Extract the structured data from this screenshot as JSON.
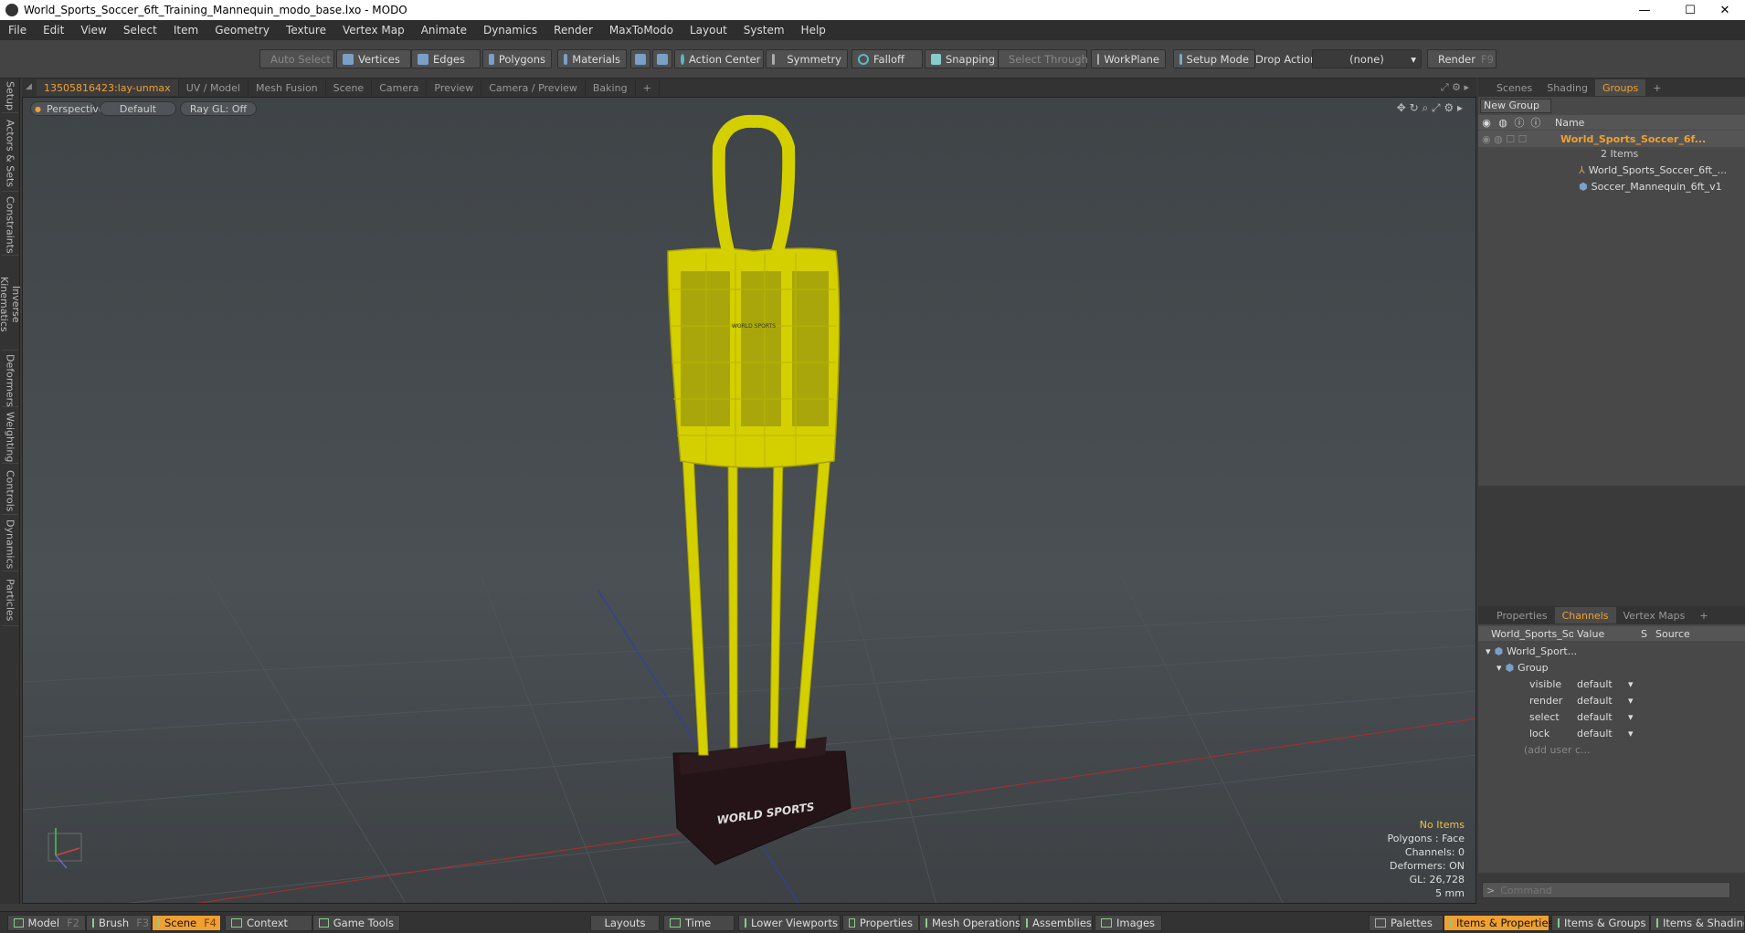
{
  "window": {
    "title": "World_Sports_Soccer_6ft_Training_Mannequin_modo_base.lxo - MODO",
    "minimize": "—",
    "maximize": "☐",
    "close": "✕"
  },
  "menu": [
    "File",
    "Edit",
    "View",
    "Select",
    "Item",
    "Geometry",
    "Texture",
    "Vertex Map",
    "Animate",
    "Dynamics",
    "Render",
    "MaxToModo",
    "Layout",
    "System",
    "Help"
  ],
  "toolbar": {
    "auto_select": "Auto Select",
    "vertices": "Vertices",
    "edges": "Edges",
    "polygons": "Polygons",
    "materials": "Materials",
    "action_center": "Action Center",
    "symmetry": "Symmetry",
    "falloff": "Falloff",
    "snapping": "Snapping",
    "select_through": "Select Through",
    "workplane": "WorkPlane",
    "setup_mode": "Setup Mode",
    "drop_action": "Drop Action",
    "drop_value": "(none)",
    "render": "Render",
    "render_key": "F9"
  },
  "left_tabs": [
    "Setup",
    "Actors & Sets",
    "Constraints",
    "Inverse Kinematics",
    "Deformers",
    "Weighting",
    "Controls",
    "Dynamics",
    "Particles"
  ],
  "viewport_tabs": [
    "13505816423:lay-unmax",
    "UV / Model",
    "Mesh Fusion",
    "Scene",
    "Camera",
    "Preview",
    "Camera / Preview",
    "Baking",
    "+"
  ],
  "viewport": {
    "view": "Perspective",
    "shading": "Default",
    "raygl": "Ray GL: Off",
    "logo_text": "WORLD SPORTS",
    "chest_text": "WORLD SPORTS",
    "info": {
      "items": "No Items",
      "polygons": "Polygons : Face",
      "channels": "Channels: 0",
      "deformers": "Deformers: ON",
      "gl": "GL: 26,728",
      "scale": "5 mm"
    }
  },
  "scene_panel": {
    "tabs": [
      "Scenes",
      "Shading",
      "Groups",
      "+"
    ],
    "new_group": "New Group",
    "col_name": "Name",
    "group_name": "World_Sports_Soccer_6f...",
    "group_count": "2 Items",
    "children": [
      "World_Sports_Soccer_6ft_...",
      "Soccer_Mannequin_6ft_v1"
    ]
  },
  "props_panel": {
    "tabs": [
      "Properties",
      "Channels",
      "Vertex Maps",
      "+"
    ],
    "headers": {
      "item": "World_Sports_So ...",
      "value": "Value",
      "s": "S",
      "source": "Source"
    },
    "item": "World_Sport...",
    "group": "Group",
    "channels": [
      {
        "name": "visible",
        "value": "default"
      },
      {
        "name": "render",
        "value": "default"
      },
      {
        "name": "select",
        "value": "default"
      },
      {
        "name": "lock",
        "value": "default"
      }
    ],
    "add_user": "(add user c..."
  },
  "command_placeholder": "Command",
  "bottom": {
    "model": "Model",
    "model_key": "F2",
    "brush": "Brush",
    "brush_key": "F3",
    "scene": "Scene",
    "scene_key": "F4",
    "context": "Context",
    "game_tools": "Game Tools",
    "layouts": "Layouts",
    "time": "Time",
    "lower_viewports": "Lower Viewports",
    "properties": "Properties",
    "mesh_operations": "Mesh Operations",
    "assemblies": "Assemblies",
    "images": "Images",
    "palettes": "Palettes",
    "items_properties": "Items & Properties",
    "items_groups": "Items & Groups",
    "items_shading": "Items & Shading"
  },
  "colors": {
    "accent": "#f0a030",
    "mesh": "#d4d000",
    "base": "#241418"
  }
}
